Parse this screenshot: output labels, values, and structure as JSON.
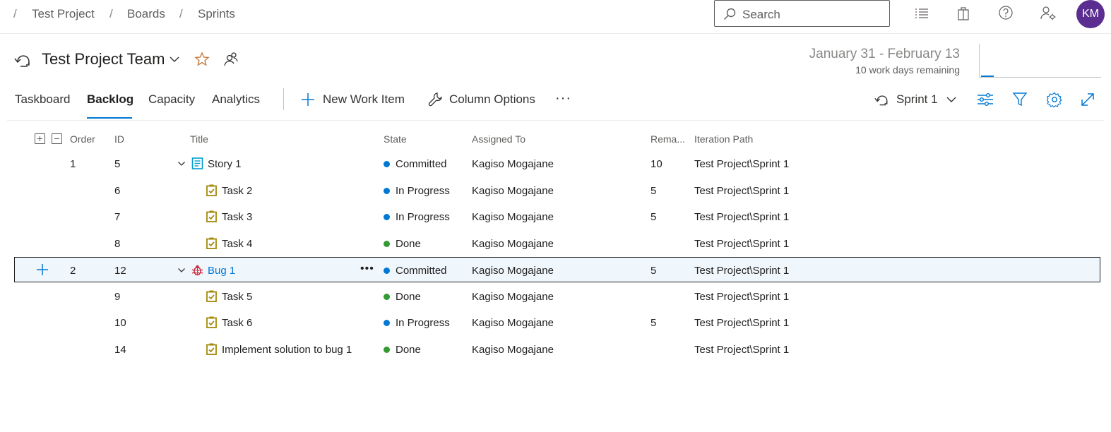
{
  "breadcrumb": {
    "separator": "/",
    "items": [
      "Test Project",
      "Boards",
      "Sprints"
    ]
  },
  "search": {
    "placeholder": "Search"
  },
  "user": {
    "initials": "KM"
  },
  "team": {
    "name": "Test Project Team"
  },
  "sprint_info": {
    "dates": "January 31 - February 13",
    "remaining": "10 work days remaining"
  },
  "tabs": [
    "Taskboard",
    "Backlog",
    "Capacity",
    "Analytics"
  ],
  "active_tab": "Backlog",
  "toolbar": {
    "new_work_item": "New Work Item",
    "column_options": "Column Options",
    "more": "···",
    "sprint_picker": "Sprint 1"
  },
  "grid": {
    "columns": {
      "order": "Order",
      "id": "ID",
      "title": "Title",
      "state": "State",
      "assigned_to": "Assigned To",
      "remaining": "Rema...",
      "iteration_path": "Iteration Path"
    },
    "rows": [
      {
        "order": "1",
        "id": "5",
        "title": "Story 1",
        "type": "story",
        "state": "Committed",
        "assigned": "Kagiso Mogajane",
        "remaining": "10",
        "path": "Test Project\\Sprint 1"
      },
      {
        "order": "",
        "id": "6",
        "title": "Task 2",
        "type": "task",
        "state": "In Progress",
        "assigned": "Kagiso Mogajane",
        "remaining": "5",
        "path": "Test Project\\Sprint 1"
      },
      {
        "order": "",
        "id": "7",
        "title": "Task 3",
        "type": "task",
        "state": "In Progress",
        "assigned": "Kagiso Mogajane",
        "remaining": "5",
        "path": "Test Project\\Sprint 1"
      },
      {
        "order": "",
        "id": "8",
        "title": "Task 4",
        "type": "task",
        "state": "Done",
        "assigned": "Kagiso Mogajane",
        "remaining": "",
        "path": "Test Project\\Sprint 1"
      },
      {
        "order": "2",
        "id": "12",
        "title": "Bug 1",
        "type": "bug",
        "state": "Committed",
        "assigned": "Kagiso Mogajane",
        "remaining": "5",
        "path": "Test Project\\Sprint 1"
      },
      {
        "order": "",
        "id": "9",
        "title": "Task 5",
        "type": "task",
        "state": "Done",
        "assigned": "Kagiso Mogajane",
        "remaining": "",
        "path": "Test Project\\Sprint 1"
      },
      {
        "order": "",
        "id": "10",
        "title": "Task 6",
        "type": "task",
        "state": "In Progress",
        "assigned": "Kagiso Mogajane",
        "remaining": "5",
        "path": "Test Project\\Sprint 1"
      },
      {
        "order": "",
        "id": "14",
        "title": "Implement solution to bug 1",
        "type": "task",
        "state": "Done",
        "assigned": "Kagiso Mogajane",
        "remaining": "",
        "path": "Test Project\\Sprint 1"
      }
    ]
  },
  "colors": {
    "accent": "#0078d4",
    "committed": "#0078d4",
    "in_progress": "#0078d4",
    "done": "#339933",
    "story_icon": "#009ccc",
    "task_icon": "#a4880a",
    "bug_icon": "#cc293d",
    "avatar": "#5c2d91"
  }
}
